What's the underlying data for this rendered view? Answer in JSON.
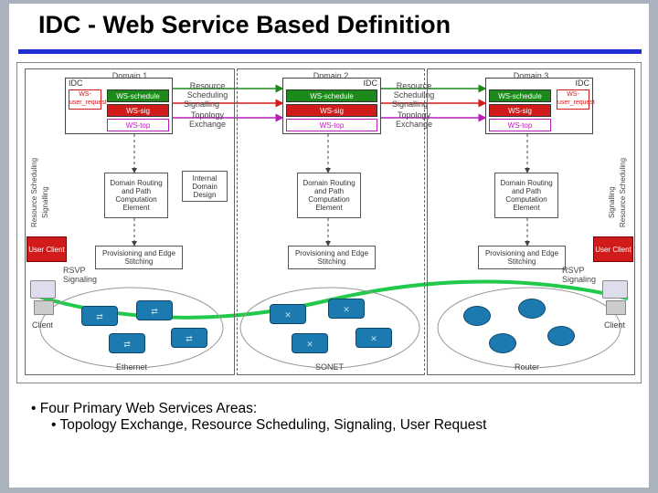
{
  "title": "IDC - Web Service Based Definition",
  "domains": {
    "d1": "Domain 1",
    "d2": "Domain 2",
    "d3": "Domain 3"
  },
  "idc_label": "IDC",
  "services": {
    "schedule": "WS-schedule",
    "sig": "WS-sig",
    "top": "WS-top",
    "user_req": "WS-user_request"
  },
  "side_labels": {
    "res_sched": "Resource Scheduling",
    "signalling": "Signalling",
    "topo_ex": "Topology Exchange"
  },
  "boxes": {
    "drpce": "Domain Routing and Path Computation Element",
    "idd": "Internal Domain Design",
    "pes": "Provisioning and Edge Stitching",
    "user_client": "User Client",
    "rsvp": "RSVP Signaling"
  },
  "net": {
    "client": "Client",
    "ethernet": "Ethernet",
    "sonet": "SONET",
    "router": "Router"
  },
  "bullets": {
    "b1": "Four Primary Web Services Areas:",
    "b2": "Topology Exchange, Resource Scheduling, Signaling, User Request"
  }
}
